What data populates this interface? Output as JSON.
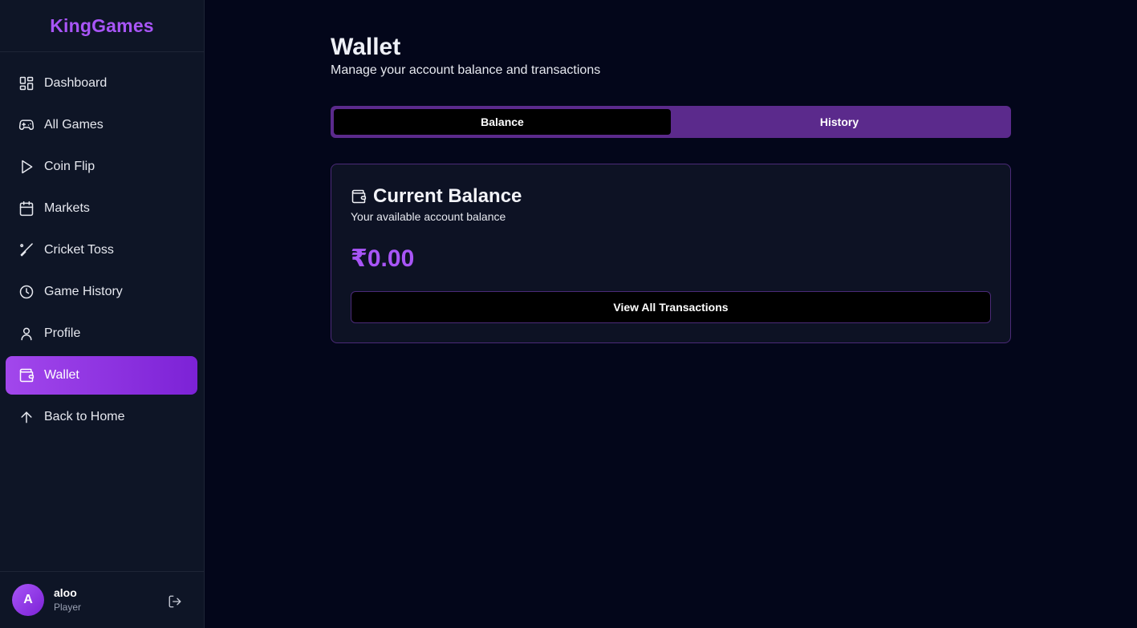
{
  "brand": {
    "name": "KingGames",
    "color": "#a855f7"
  },
  "sidebar": {
    "items": [
      {
        "label": "Dashboard",
        "icon": "dashboard-icon"
      },
      {
        "label": "All Games",
        "icon": "gamepad-icon"
      },
      {
        "label": "Coin Flip",
        "icon": "play-icon"
      },
      {
        "label": "Markets",
        "icon": "calendar-icon"
      },
      {
        "label": "Cricket Toss",
        "icon": "cricket-bat-icon"
      },
      {
        "label": "Game History",
        "icon": "clock-icon"
      },
      {
        "label": "Profile",
        "icon": "user-icon"
      },
      {
        "label": "Wallet",
        "icon": "wallet-icon",
        "active": true
      },
      {
        "label": "Back to Home",
        "icon": "arrow-up-icon"
      }
    ]
  },
  "user": {
    "initial": "A",
    "name": "aloo",
    "role": "Player"
  },
  "page": {
    "title": "Wallet",
    "subtitle": "Manage your account balance and transactions"
  },
  "tabs": [
    {
      "label": "Balance",
      "active": true
    },
    {
      "label": "History",
      "active": false
    }
  ],
  "balance_card": {
    "icon": "wallet-icon",
    "title": "Current Balance",
    "subtitle": "Your available account balance",
    "amount": "₹0.00",
    "button_label": "View All Transactions"
  },
  "colors": {
    "accent": "#a855f7",
    "background": "#03061a",
    "sidebar": "#0e1526",
    "tab_bar": "#5b2a8c"
  }
}
